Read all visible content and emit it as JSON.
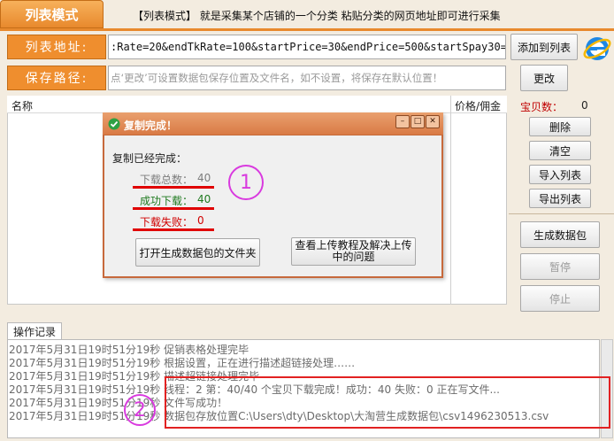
{
  "header": {
    "mode_tab": "列表模式",
    "tip": "【列表模式】 就是采集某个店铺的一个分类  粘贴分类的网页地址即可进行采集"
  },
  "url_row": {
    "label": "列表地址:",
    "value": ":Rate=20&endTkRate=100&startPrice=30&endPrice=500&startSpay30=10",
    "add_button": "添加到列表"
  },
  "save_row": {
    "label": "保存路径:",
    "placeholder": "点‘更改’可设置数据包保存位置及文件名，如不设置，将保存在默认位置！",
    "change_button": "更改"
  },
  "list": {
    "col_name": "名称",
    "col_price": "价格/佣金"
  },
  "right_panel": {
    "count_label": "宝贝数：",
    "count_value": "0",
    "buttons": [
      "删除",
      "清空",
      "导入列表",
      "导出列表"
    ],
    "generate": "生成数据包",
    "pause": "暂停",
    "stop": "停止"
  },
  "dialog": {
    "title": "复制完成！",
    "heading": "复制已经完成：",
    "total_label": "下载总数：",
    "total_value": "40",
    "success_label": "成功下载：",
    "success_value": "40",
    "fail_label": "下载失败：",
    "fail_value": "0",
    "open_folder_button": "打开生成数据包的文件夹",
    "tutorial_button_line1": "查看上传教程及解决上传",
    "tutorial_button_line2": "中的问题"
  },
  "annotations": {
    "circle1": "1",
    "circle2": "2"
  },
  "log": {
    "tab": "操作记录",
    "lines": [
      "2017年5月31日19时51分19秒   促销表格处理完毕",
      "2017年5月31日19时51分19秒   根据设置，正在进行描述超链接处理……",
      "2017年5月31日19时51分19秒   描述超链接处理完毕",
      "2017年5月31日19时51分19秒   线程：2 第：40/40 个宝贝下载完成！成功：40 失败：0 正在写文件...",
      "2017年5月31日19时51分19秒   文件写成功！",
      "2017年5月31日19时51分19秒 数据包存放位置C:\\Users\\dty\\Desktop\\大淘营生成数据包\\csv1496230513.csv"
    ]
  },
  "colors": {
    "accent": "#ef8e2e",
    "dialog_title": "#d97a45",
    "red": "#e00000",
    "annotation": "#d93adf"
  }
}
